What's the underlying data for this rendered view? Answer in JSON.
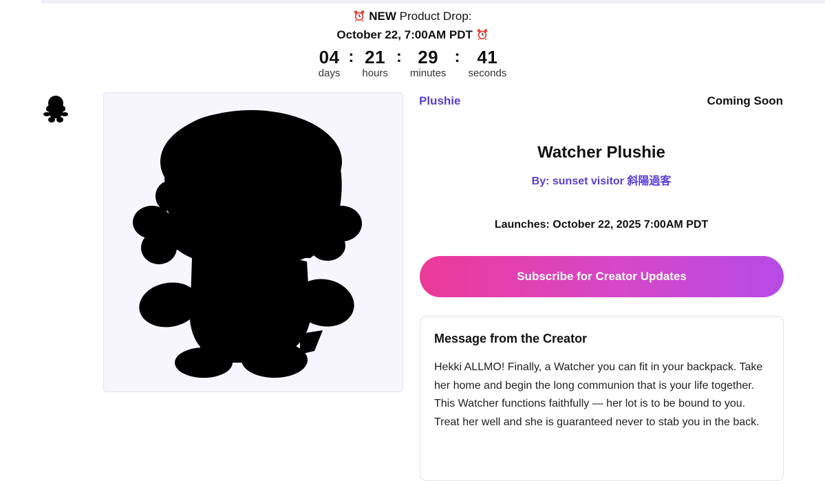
{
  "countdown": {
    "new_label": "NEW",
    "drop_label": "Product Drop:",
    "date_label": "October 22, 7:00AM PDT",
    "units": [
      {
        "value": "04",
        "label": "days"
      },
      {
        "value": "21",
        "label": "hours"
      },
      {
        "value": "29",
        "label": "minutes"
      },
      {
        "value": "41",
        "label": "seconds"
      }
    ]
  },
  "product": {
    "category": "Plushie",
    "status": "Coming Soon",
    "title": "Watcher Plushie",
    "byline": "By: sunset visitor 斜陽過客",
    "launch": "Launches: October 22, 2025 7:00AM PDT",
    "subscribe_label": "Subscribe for Creator Updates"
  },
  "message": {
    "title": "Message from the Creator",
    "body": "Hekki ALLMO! Finally, a Watcher you can fit in your backpack. Take her home and begin the long communion that is your life together. This Watcher functions faithfully — her lot is to be bound to you. Treat her well and she is guaranteed never to stab you in the back."
  },
  "icons": {
    "alarm": "alarm-clock-icon",
    "avatar": "plushie-silhouette-avatar"
  },
  "colors": {
    "accent": "#5a3ed9",
    "button_start": "#ec3a98",
    "button_end": "#b74ae6",
    "image_bg": "#f7f6fd"
  }
}
